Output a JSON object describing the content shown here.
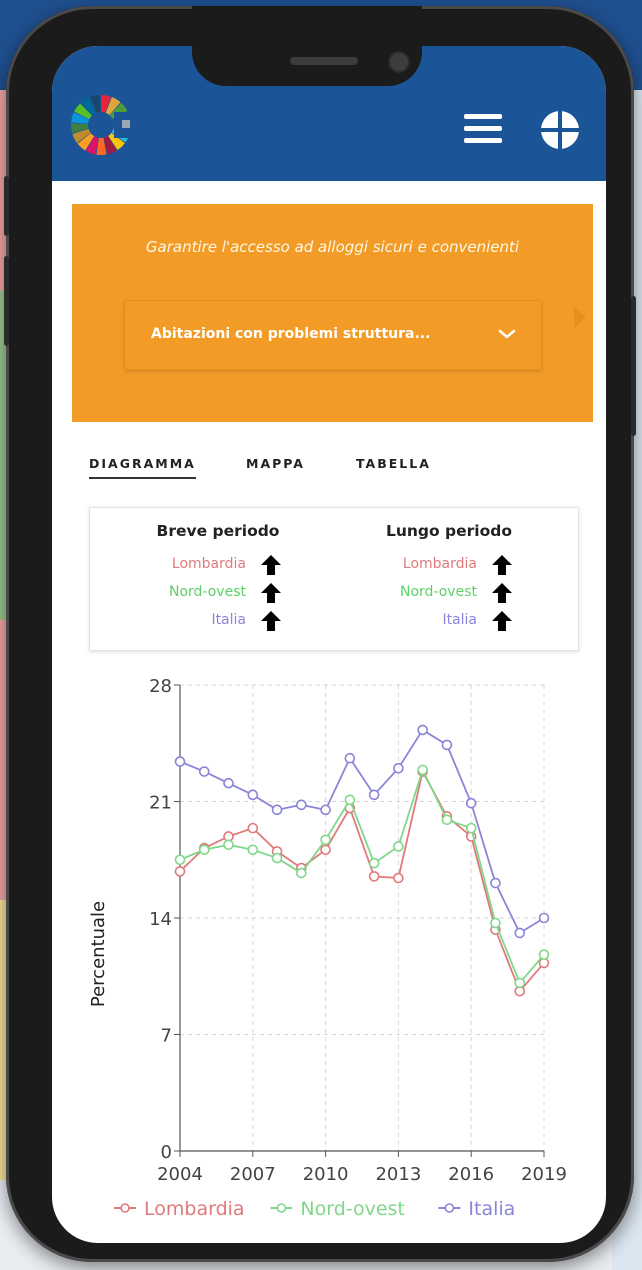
{
  "header": {
    "logo_icon": "sdg-wheel-logo",
    "menu_icon": "hamburger-menu-icon",
    "apps_icon": "grid-apps-icon",
    "color": "#1b5597"
  },
  "hero": {
    "subtitle": "Garantire l'accesso ad alloggi sicuri e convenienti",
    "indicator": "Abitazioni con problemi struttura...",
    "color": "#f29c27"
  },
  "tabs": [
    {
      "label": "DIAGRAMMA",
      "active": true
    },
    {
      "label": "MAPPA",
      "active": false
    },
    {
      "label": "TABELLA",
      "active": false
    }
  ],
  "trend": {
    "short_term": {
      "title": "Breve periodo",
      "rows": [
        {
          "name": "Lombardia",
          "color": "#e07a7a",
          "arrow": "up"
        },
        {
          "name": "Nord-ovest",
          "color": "#5fcf6a",
          "arrow": "up"
        },
        {
          "name": "Italia",
          "color": "#8a85d8",
          "arrow": "up"
        }
      ]
    },
    "long_term": {
      "title": "Lungo periodo",
      "rows": [
        {
          "name": "Lombardia",
          "color": "#e07a7a",
          "arrow": "up"
        },
        {
          "name": "Nord-ovest",
          "color": "#5fcf6a",
          "arrow": "up"
        },
        {
          "name": "Italia",
          "color": "#8a85d8",
          "arrow": "up"
        }
      ]
    }
  },
  "chart_data": {
    "type": "line",
    "ylabel": "Percentuale",
    "xlabel": "",
    "x": [
      2004,
      2005,
      2006,
      2007,
      2008,
      2009,
      2010,
      2011,
      2012,
      2013,
      2014,
      2015,
      2016,
      2017,
      2018,
      2019
    ],
    "xticks": [
      "2004",
      "2007",
      "2010",
      "2013",
      "2016",
      "2019"
    ],
    "yticks": [
      "0",
      "7",
      "14",
      "21",
      "28"
    ],
    "ylim": [
      0,
      28
    ],
    "grid": true,
    "legend_position": "bottom",
    "series": [
      {
        "name": "Lombardia",
        "color": "#e07a7a",
        "values": [
          16.8,
          18.2,
          18.9,
          19.4,
          18.0,
          17.0,
          18.1,
          20.6,
          16.5,
          16.4,
          22.8,
          20.1,
          18.9,
          13.3,
          9.6,
          11.3
        ]
      },
      {
        "name": "Nord-ovest",
        "color": "#7fd88a",
        "values": [
          17.5,
          18.1,
          18.4,
          18.1,
          17.6,
          16.7,
          18.7,
          21.1,
          17.3,
          18.3,
          22.9,
          19.9,
          19.4,
          13.7,
          10.1,
          11.8
        ]
      },
      {
        "name": "Italia",
        "color": "#8a85d8",
        "values": [
          23.4,
          22.8,
          22.1,
          21.4,
          20.5,
          20.8,
          20.5,
          23.6,
          21.4,
          23.0,
          25.3,
          24.4,
          20.9,
          16.1,
          13.1,
          14.0
        ]
      }
    ]
  }
}
